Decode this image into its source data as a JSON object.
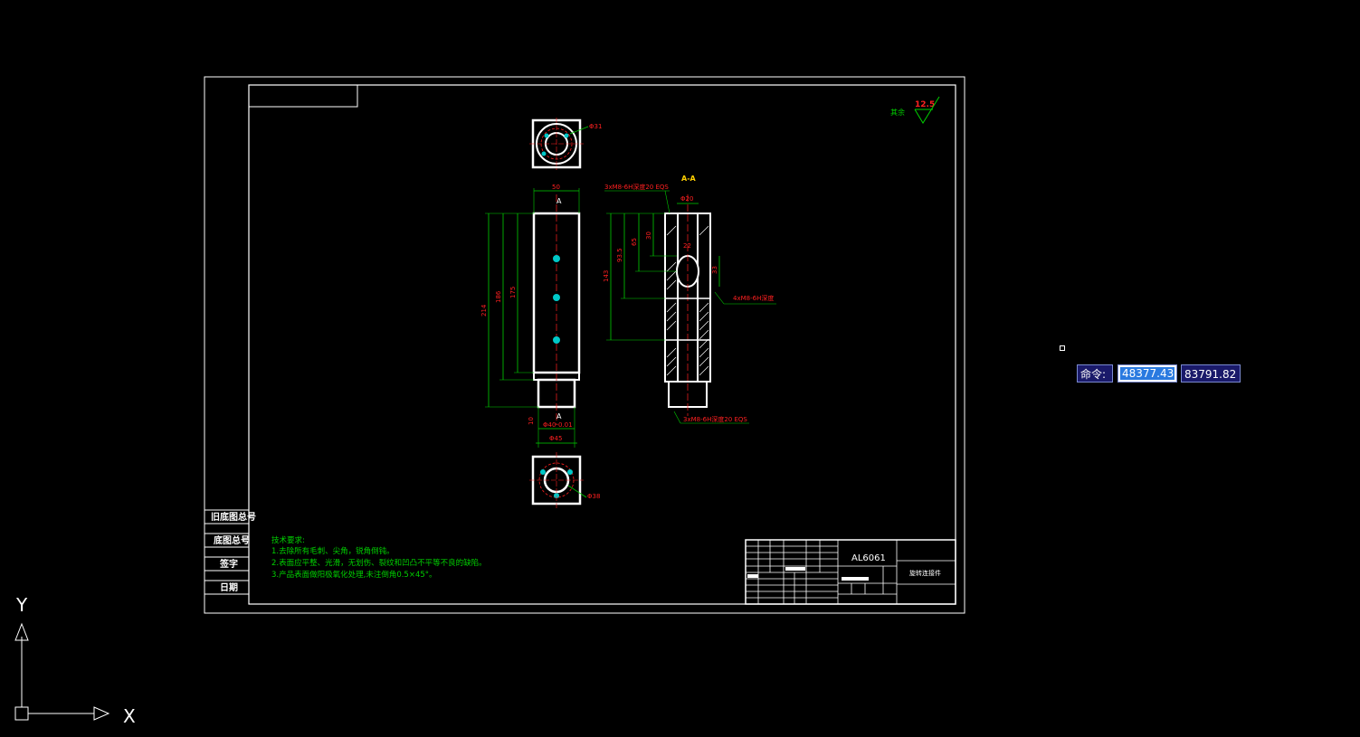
{
  "command_line": {
    "label": "命令:",
    "x_value": "48377.43",
    "y_value": "83791.82"
  },
  "ucs": {
    "x_label": "X",
    "y_label": "Y"
  },
  "drawing": {
    "roughness_label": "其余",
    "roughness_value": "12.5",
    "section_label": "A-A",
    "section_marker": "A",
    "dims": {
      "top_dia": "Φ31",
      "width50": "50",
      "h214": "214",
      "h186": "186",
      "h175": "175",
      "dia40": "Φ40-0.01",
      "dia45": "Φ45",
      "h10": "10",
      "thread_top": "3xM8-6H深度20 EQS",
      "dia20": "Φ20",
      "h143": "143",
      "h93": "93.5",
      "h65": "65",
      "h30": "30",
      "w22": "22",
      "v33": "33",
      "thread_side": "4xM8-6H深度",
      "thread_bottom": "3xM8-6H深度20 EQS",
      "bottom_dia": "Φ38"
    },
    "tech_requirements": {
      "title": "技术要求:",
      "lines": [
        "1.去除所有毛刺、尖角，锐角倒钝。",
        "2.表面应平整、光滑，无划伤、裂纹和凹凸不平等不良的缺陷。",
        "3.产品表面做阳极氧化处理,未注倒角0.5×45°。"
      ]
    },
    "side_labels": [
      "旧底图总号",
      "底图总号",
      "签字",
      "日期"
    ],
    "title_block": {
      "material": "AL6061",
      "part_name": "旋转连接件"
    }
  }
}
